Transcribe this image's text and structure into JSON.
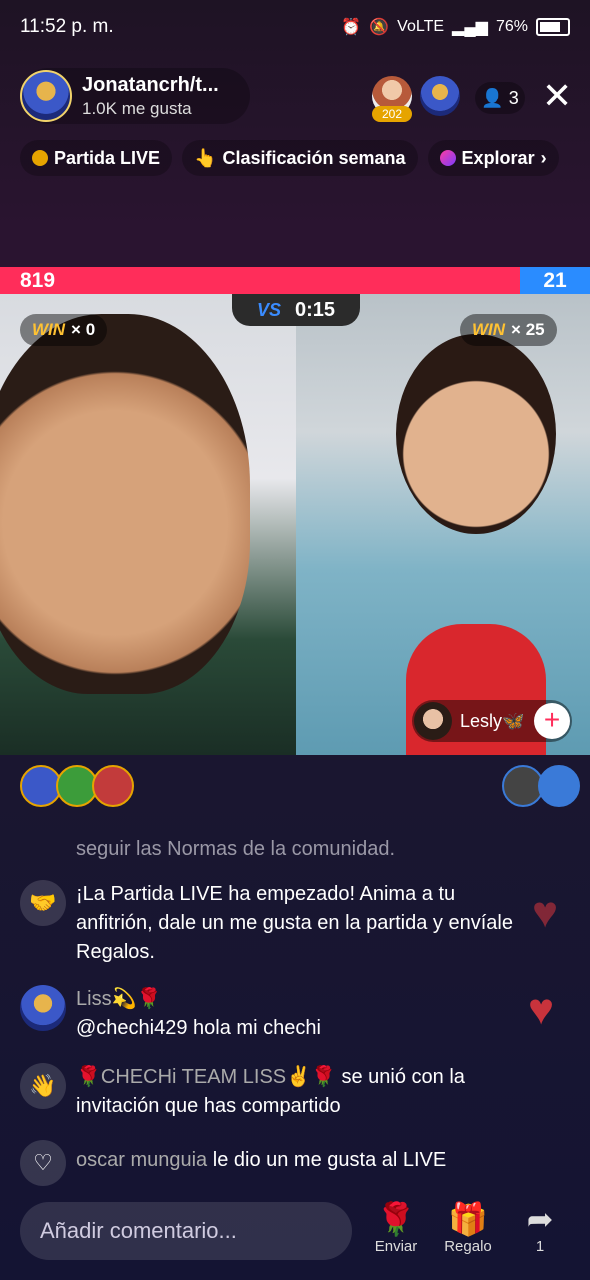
{
  "status": {
    "time": "11:52 p. m.",
    "network": "VoLTE",
    "battery": "76%"
  },
  "host": {
    "name": "Jonatancrh/t...",
    "likes": "1.0K me gusta"
  },
  "viewers": {
    "rank": "202",
    "count": "3"
  },
  "chips": [
    {
      "label": "Partida LIVE",
      "icon": "star-icon"
    },
    {
      "label": "Clasificación semana",
      "icon": "hand-icon"
    },
    {
      "label": "Explorar",
      "icon": "explore-icon"
    }
  ],
  "battle": {
    "score_left": "819",
    "score_right": "21",
    "timer": "0:15",
    "vs": "VS",
    "win_left": "× 0",
    "win_right": "× 25",
    "win_label": "WIN",
    "guest_name": "Lesly🦋"
  },
  "chat": {
    "rules_note": "seguir las Normas de la comunidad.",
    "system_msg": "¡La Partida LIVE ha empezado! Anima a tu anfitrión, dale un me gusta en la partida y envíale Regalos.",
    "msg1_user": "Liss💫🌹",
    "msg1_text": "@chechi429 hola mi chechi",
    "msg2_user": "🌹CHECHi  TEAM  LISS✌️🌹",
    "msg2_text": "se unió con la invitación que has compartido",
    "msg3_user": "oscar munguia",
    "msg3_text": "le dio un me gusta al LIVE"
  },
  "bottom": {
    "placeholder": "Añadir comentario...",
    "send_label": "Enviar",
    "gift_label": "Regalo",
    "share_count": "1"
  },
  "colors": {
    "red": "#ff2d5a",
    "blue": "#2a8cff",
    "gold": "#ffc233"
  }
}
